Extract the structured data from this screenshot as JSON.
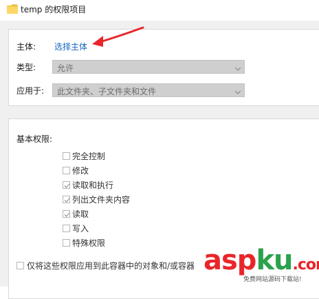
{
  "window": {
    "title": "temp 的权限项目"
  },
  "principal": {
    "label": "主体:",
    "link": "选择主体"
  },
  "type": {
    "label": "类型:",
    "value": "允许"
  },
  "applies": {
    "label": "应用于:",
    "value": "此文件夹、子文件夹和文件"
  },
  "basic": {
    "label": "基本权限:",
    "items": [
      {
        "label": "完全控制",
        "checked": false
      },
      {
        "label": "修改",
        "checked": false
      },
      {
        "label": "读取和执行",
        "checked": true
      },
      {
        "label": "列出文件夹内容",
        "checked": true
      },
      {
        "label": "读取",
        "checked": true
      },
      {
        "label": "写入",
        "checked": false
      },
      {
        "label": "特殊权限",
        "checked": false
      }
    ]
  },
  "footer": {
    "label": "仅将这些权限应用到此容器中的对象和/或容器"
  },
  "watermark": {
    "brand_a": "asp",
    "brand_b": "ku",
    "domain": ".com",
    "tagline": "免费网站源码下载站!"
  },
  "colors": {
    "link": "#1565c0",
    "annotation_arrow": "#e8262a",
    "disabled_combo": "#cfcfcf"
  },
  "icons": {
    "folder": "folder-icon",
    "dropdown": "chevron-down-icon",
    "check": "checkmark-icon"
  }
}
